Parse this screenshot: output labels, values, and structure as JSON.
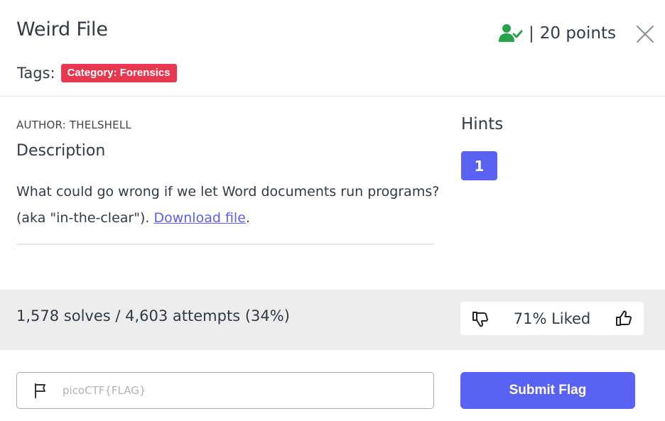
{
  "challenge": {
    "title": "Weird File",
    "points_separator": "|",
    "points": "20 points",
    "solved_icon": "user-check-icon",
    "close_icon": "close-icon"
  },
  "tags": {
    "label": "Tags:",
    "items": [
      "Category: Forensics"
    ]
  },
  "content": {
    "author": "AUTHOR: THELSHELL",
    "description_heading": "Description",
    "description_line1": "What could go wrong if we let Word documents run programs?",
    "description_line2_prefix": "(aka \"in-the-clear\"). ",
    "download_link": "Download file",
    "description_suffix": "."
  },
  "hints": {
    "heading": "Hints",
    "buttons": [
      "1"
    ]
  },
  "stats": {
    "solves_text": "1,578 solves / 4,603 attempts (34%)",
    "liked_text": "71% Liked",
    "liked_percent": 71
  },
  "flag_form": {
    "placeholder": "picoCTF{FLAG}",
    "value": "",
    "submit_label": "Submit Flag"
  },
  "colors": {
    "accent": "#5a62f4",
    "tag_red": "#e8384f",
    "solved_green": "#27a14a",
    "band_gray": "#ededed"
  }
}
